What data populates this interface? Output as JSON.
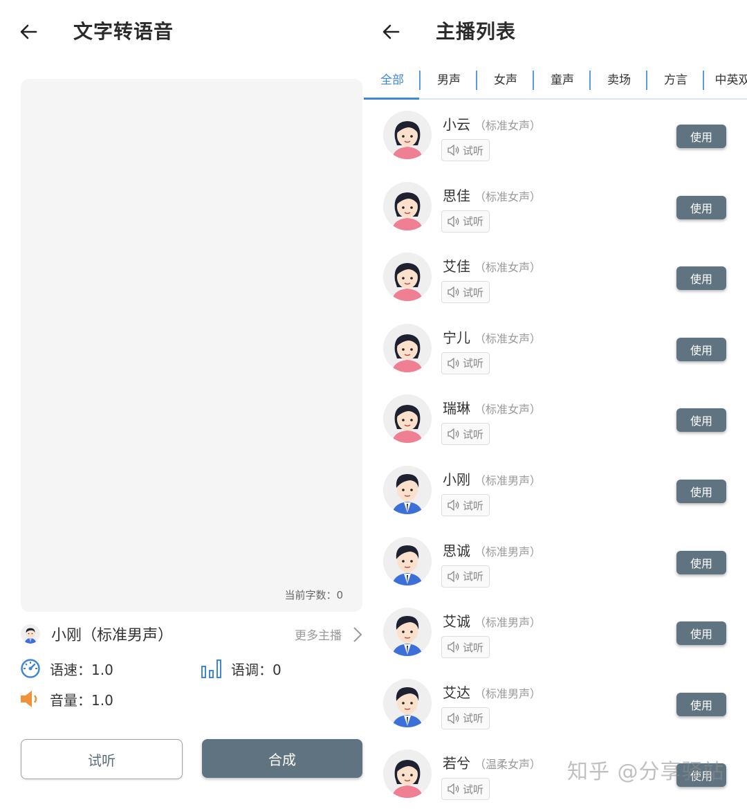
{
  "left": {
    "title": "文字转语音",
    "char_count": "当前字数：0",
    "selected_voice": "小刚（标准男声）",
    "more_link": "更多主播",
    "speed": "语速：1.0",
    "pitch": "语调：0",
    "volume": "音量：1.0",
    "listen_button": "试听",
    "synth_button": "合成"
  },
  "right": {
    "title": "主播列表",
    "tabs": [
      {
        "label": "全部",
        "active": true
      },
      {
        "label": "男声"
      },
      {
        "label": "女声"
      },
      {
        "label": "童声"
      },
      {
        "label": "卖场"
      },
      {
        "label": "方言"
      },
      {
        "label": "中英双"
      }
    ],
    "voices": [
      {
        "name": "小云",
        "type": "（标准女声）",
        "gender": "female",
        "listen": "试听",
        "use": "使用"
      },
      {
        "name": "思佳",
        "type": "（标准女声）",
        "gender": "female",
        "listen": "试听",
        "use": "使用"
      },
      {
        "name": "艾佳",
        "type": "（标准女声）",
        "gender": "female",
        "listen": "试听",
        "use": "使用"
      },
      {
        "name": "宁儿",
        "type": "（标准女声）",
        "gender": "female",
        "listen": "试听",
        "use": "使用"
      },
      {
        "name": "瑞琳",
        "type": "（标准女声）",
        "gender": "female",
        "listen": "试听",
        "use": "使用"
      },
      {
        "name": "小刚",
        "type": "（标准男声）",
        "gender": "male",
        "listen": "试听",
        "use": "使用"
      },
      {
        "name": "思诚",
        "type": "（标准男声）",
        "gender": "male",
        "listen": "试听",
        "use": "使用"
      },
      {
        "name": "艾诚",
        "type": "（标准男声）",
        "gender": "male",
        "listen": "试听",
        "use": "使用"
      },
      {
        "name": "艾达",
        "type": "（标准男声）",
        "gender": "male",
        "listen": "试听",
        "use": "使用"
      },
      {
        "name": "若兮",
        "type": "（温柔女声）",
        "gender": "female",
        "listen": "试听",
        "use": "使用"
      }
    ]
  },
  "watermark": "知乎 @分享驿站",
  "colors": {
    "accent": "#3e86d6",
    "button": "#5f7480"
  }
}
